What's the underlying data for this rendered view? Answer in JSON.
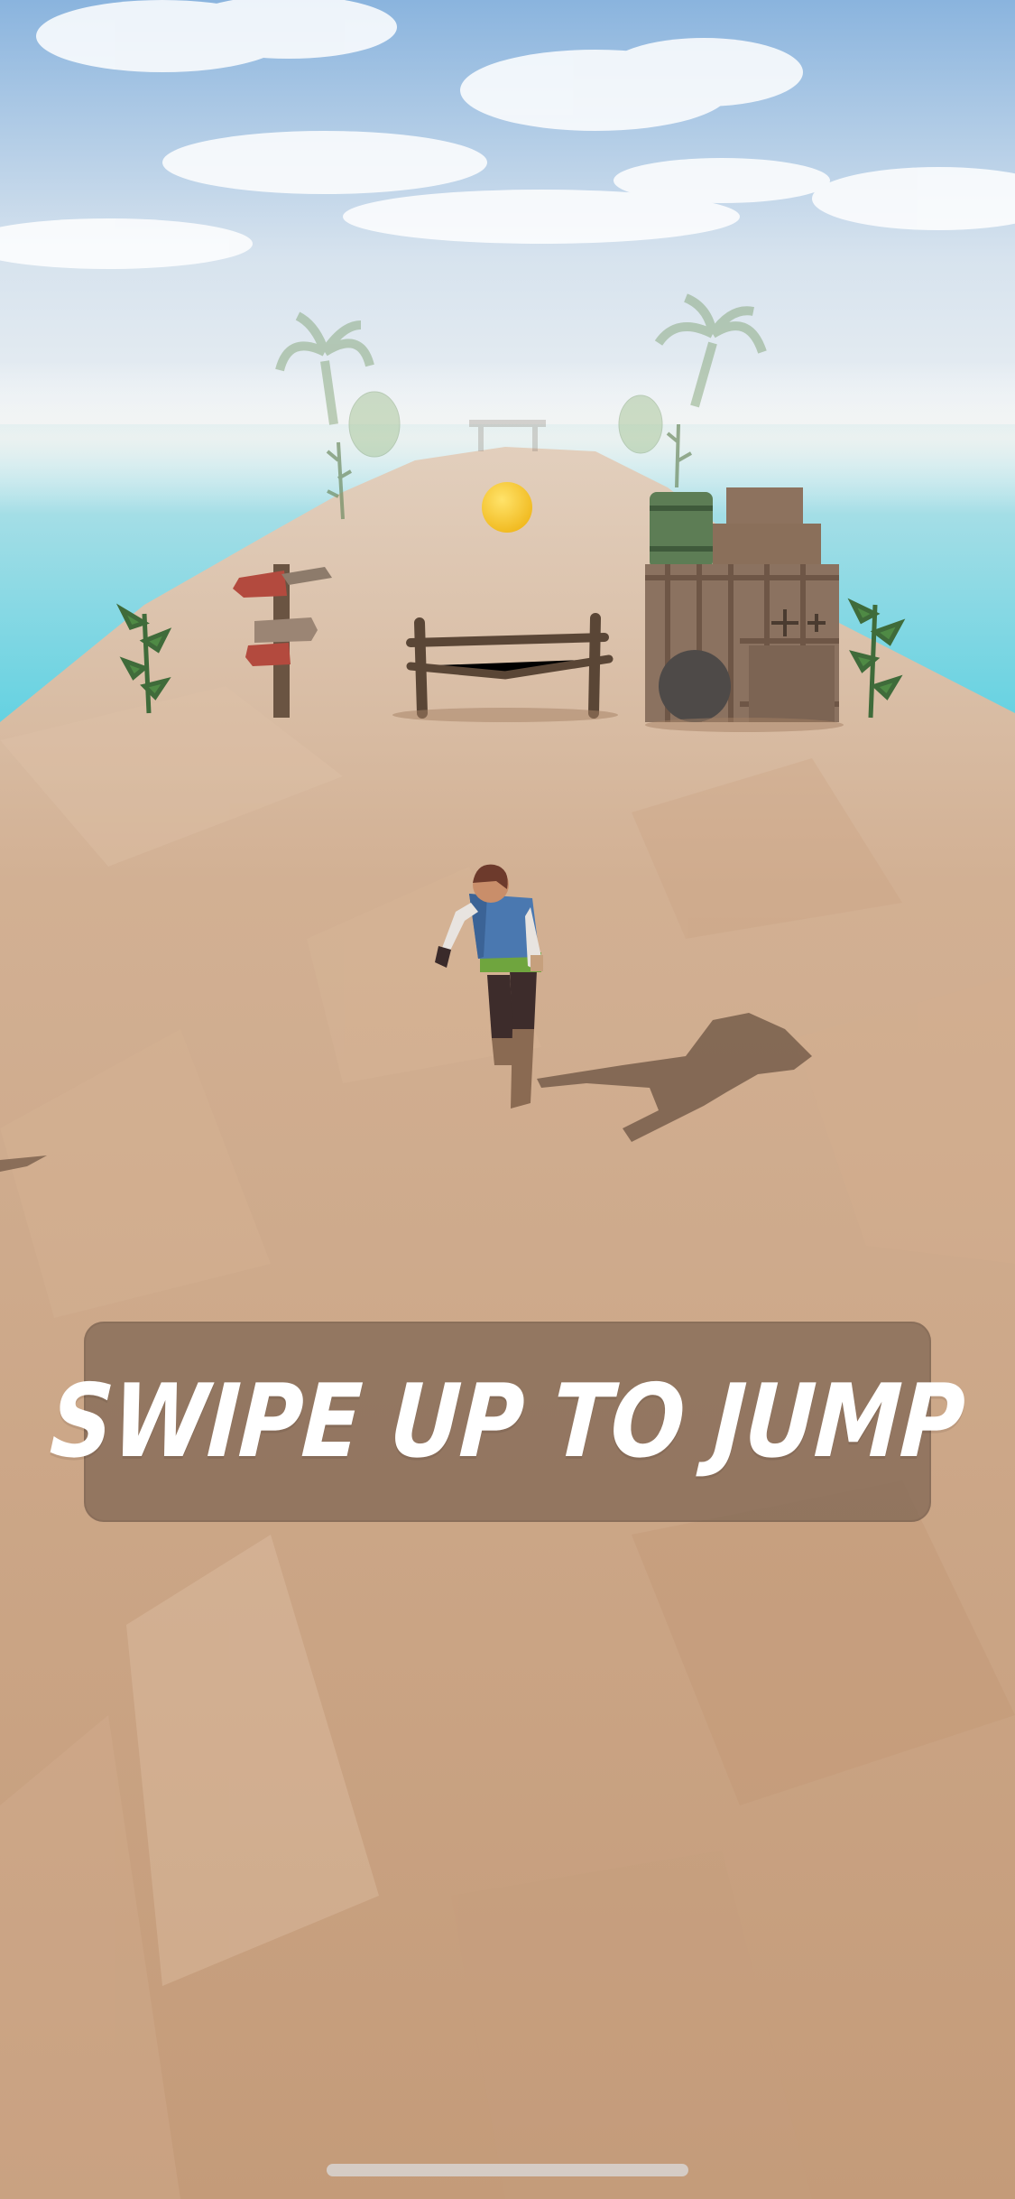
{
  "tutorial": {
    "instruction": "SWIPE UP TO JUMP"
  },
  "colors": {
    "sky_top": "#8fb8e0",
    "sky_bottom": "#e8eef3",
    "sea": "#6fd0df",
    "sand": "#c9a07f",
    "banner_bg": "#7d6452",
    "coin": "#f6c52c",
    "text": "#ffffff"
  },
  "icons": {
    "coin": "coin-icon",
    "player": "runner-character",
    "home_indicator": "home-indicator-bar"
  }
}
